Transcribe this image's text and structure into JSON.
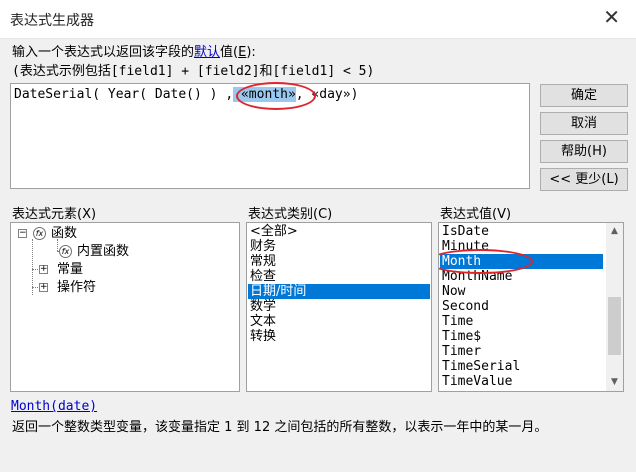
{
  "window": {
    "title": "表达式生成器"
  },
  "instructions": {
    "line1_before": "输入一个表达式以返回该字段的",
    "line1_link": "默认",
    "line1_after": "值(",
    "line1_key": "E",
    "line1_end": "):",
    "line2": "(表达式示例包括[field1] + [field2]和[field1] < 5)"
  },
  "expression": {
    "before": "DateSerial( Year( Date() ) ,",
    "selected": " «month»",
    "after": ", «day»)"
  },
  "buttons": {
    "ok": "确定",
    "cancel": "取消",
    "help": "帮助(H)",
    "less": "<< 更少(L)"
  },
  "elements": {
    "label": "表达式元素(X)",
    "tree": [
      {
        "label": "函数",
        "expanded": "−"
      },
      {
        "label": "内置函数"
      },
      {
        "label": "常量",
        "expanded": "+"
      },
      {
        "label": "操作符",
        "expanded": "+"
      }
    ]
  },
  "categories": {
    "label": "表达式类别(C)",
    "items": [
      "<全部>",
      "财务",
      "常规",
      "检查",
      "日期/时间",
      "数学",
      "文本",
      "转换"
    ],
    "selected_index": 4
  },
  "values": {
    "label": "表达式值(V)",
    "items": [
      "IsDate",
      "Minute",
      "Month",
      "MonthName",
      "Now",
      "Second",
      "Time",
      "Time$",
      "Timer",
      "TimeSerial",
      "TimeValue"
    ],
    "selected_index": 2
  },
  "help": {
    "link": "Month(date)",
    "description": "返回一个整数类型变量，该变量指定 1 到 12 之间包括的所有整数，以表示一年中的某一月。"
  },
  "icons": {
    "close": "✕",
    "fx": "fx",
    "scroll_up": "▲",
    "scroll_down": "▼"
  },
  "colors": {
    "selection": "#0078d7",
    "text_selection": "#99c9ef",
    "annotation": "#e0242c",
    "link": "#0000cc"
  }
}
